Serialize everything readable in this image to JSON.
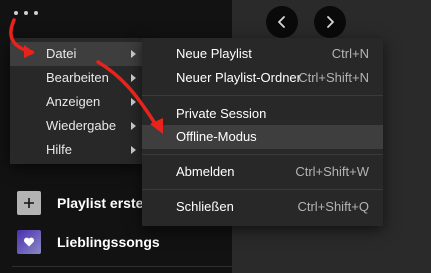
{
  "colors": {
    "background": "#121212",
    "menu_bg": "#282828",
    "highlight": "#3e3e3e",
    "annotation_red": "#e8231c"
  },
  "top_bar": {
    "menu_icon": "more-dots-icon",
    "back_icon": "chevron-left-icon",
    "forward_icon": "chevron-right-icon"
  },
  "main_menu": {
    "items": [
      {
        "label": "Datei",
        "active": true
      },
      {
        "label": "Bearbeiten",
        "active": false
      },
      {
        "label": "Anzeigen",
        "active": false
      },
      {
        "label": "Wiedergabe",
        "active": false
      },
      {
        "label": "Hilfe",
        "active": false
      }
    ]
  },
  "submenu": {
    "items": [
      {
        "label": "Neue Playlist",
        "shortcut": "Ctrl+N"
      },
      {
        "label": "Neuer Playlist-Ordner",
        "shortcut": "Ctrl+Shift+N"
      },
      {
        "label": "Private Session",
        "shortcut": ""
      },
      {
        "label": "Offline-Modus",
        "shortcut": "",
        "highlighted": true
      },
      {
        "label": "Abmelden",
        "shortcut": "Ctrl+Shift+W"
      },
      {
        "label": "Schließen",
        "shortcut": "Ctrl+Shift+Q"
      }
    ]
  },
  "library": {
    "create_playlist": "Playlist erste",
    "liked_songs": "Lieblingssongs"
  }
}
